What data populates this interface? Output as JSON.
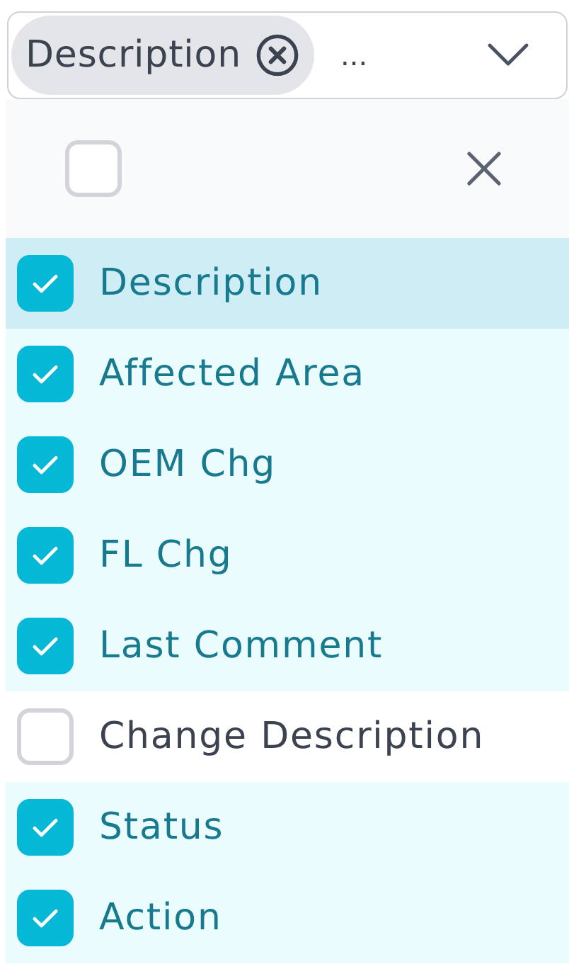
{
  "select": {
    "chips": [
      {
        "label": "Description"
      }
    ],
    "overflow": "..."
  },
  "select_all": {
    "checked": false
  },
  "options": [
    {
      "label": "Description",
      "checked": true,
      "highlighted": true
    },
    {
      "label": "Affected Area",
      "checked": true,
      "highlighted": false
    },
    {
      "label": "OEM Chg",
      "checked": true,
      "highlighted": false
    },
    {
      "label": "FL Chg",
      "checked": true,
      "highlighted": false
    },
    {
      "label": "Last Comment",
      "checked": true,
      "highlighted": false
    },
    {
      "label": "Change Description",
      "checked": false,
      "highlighted": false
    },
    {
      "label": "Status",
      "checked": true,
      "highlighted": false
    },
    {
      "label": "Action",
      "checked": true,
      "highlighted": false
    }
  ]
}
